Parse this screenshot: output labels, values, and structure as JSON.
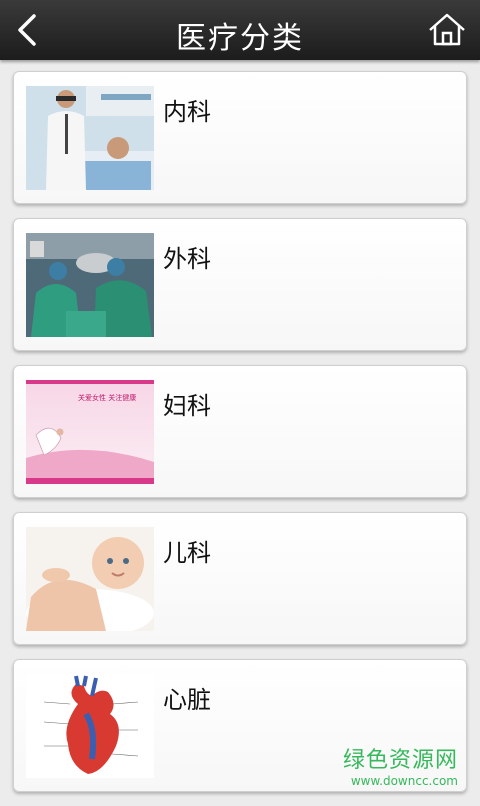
{
  "header": {
    "title": "医疗分类",
    "back_icon": "chevron-left-icon",
    "home_icon": "home-icon",
    "background": "#262626"
  },
  "categories": [
    {
      "label": "内科",
      "icon": "internal-medicine-photo"
    },
    {
      "label": "外科",
      "icon": "surgery-photo"
    },
    {
      "label": "妇科",
      "icon": "gynecology-photo"
    },
    {
      "label": "儿科",
      "icon": "pediatrics-photo"
    },
    {
      "label": "心脏",
      "icon": "heart-anatomy-photo"
    }
  ],
  "gyn_banner_text": "关爱女性 关注健康",
  "watermark": {
    "text": "绿色资源网",
    "url": "www.downcc.com",
    "color": "#22b24c"
  }
}
